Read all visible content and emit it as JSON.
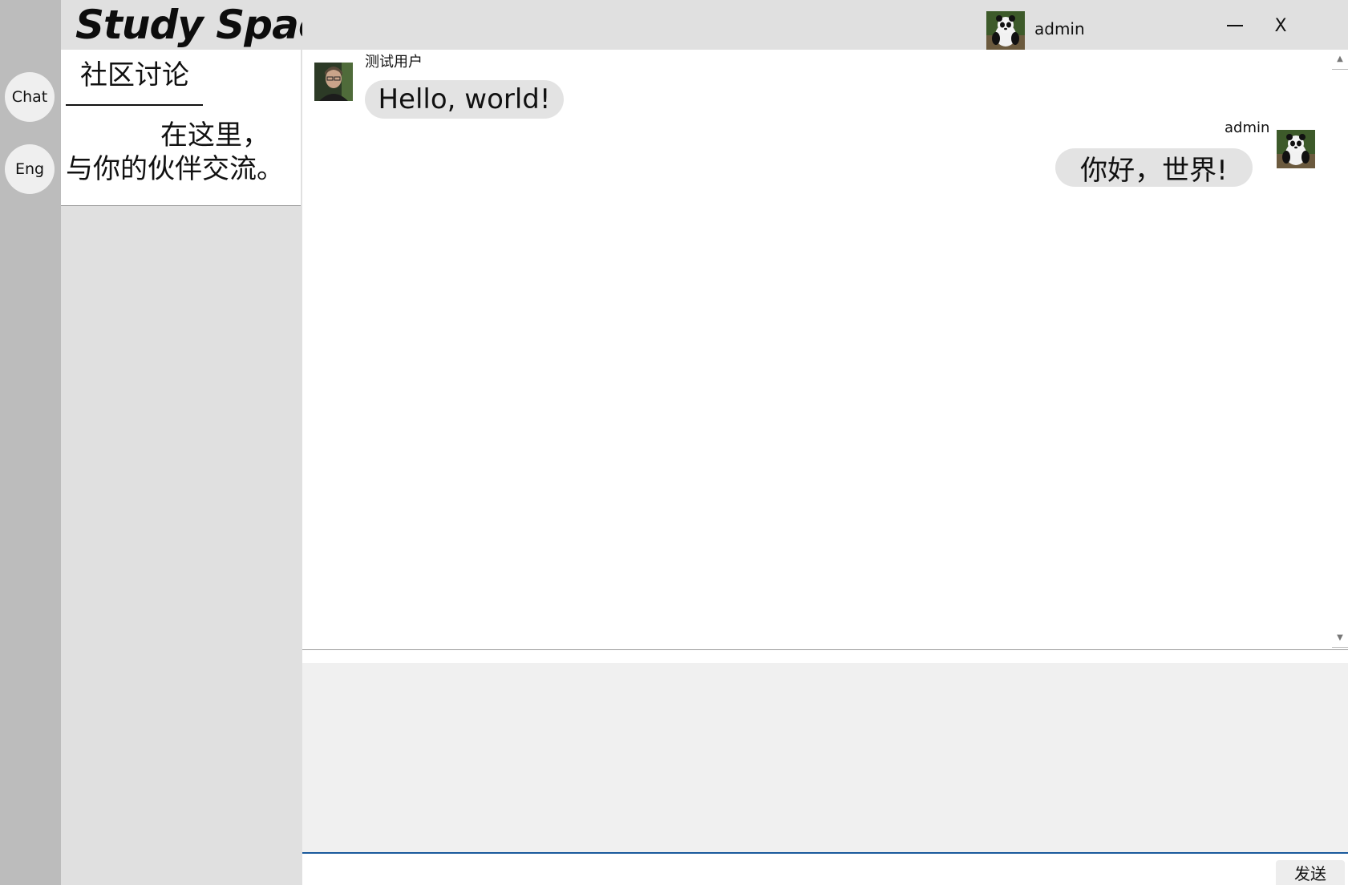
{
  "app": {
    "logo": "Study Space"
  },
  "rail": {
    "chat_label": "Chat",
    "lang_label": "Eng"
  },
  "sidebar": {
    "card": {
      "title": "社区讨论",
      "description": "在这里，与你的伙伴交流。"
    }
  },
  "header": {
    "username": "admin",
    "minimize_icon": "minimize-icon",
    "close_label": "X"
  },
  "messages": [
    {
      "sender": "测试用户",
      "text": "Hello, world!",
      "side": "left"
    },
    {
      "sender": "admin",
      "text": "你好，世界!",
      "side": "right"
    }
  ],
  "composer": {
    "value": "",
    "send_label": "发送"
  },
  "colors": {
    "rail": "#bcbcbc",
    "sidebar": "#e0e0e0",
    "bubble": "#e3e3e3",
    "input_focus_line": "#1a5a9c"
  }
}
